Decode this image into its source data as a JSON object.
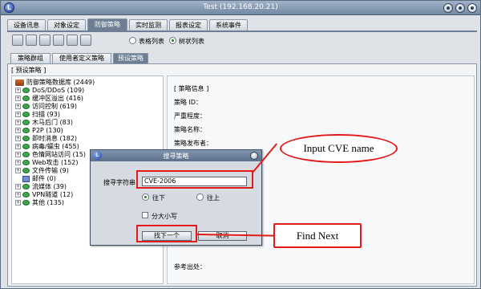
{
  "window": {
    "title": "Test (192.168.20.21)"
  },
  "main_tabs": [
    "设备讯息",
    "对象设定",
    "防御策略",
    "实时监测",
    "报表设定",
    "系统事件"
  ],
  "view_options": {
    "table_list": "表格列表",
    "tree_list": "树状列表"
  },
  "sub_tabs": [
    "策略群组",
    "使用者定义策略",
    "预设策略"
  ],
  "panel_label": "[ 预设策略 ]",
  "tree": {
    "root": "防御策略数据库 (2449)",
    "items": [
      "DoS/DDoS (109)",
      "缓冲区溢出 (416)",
      "访问控制 (619)",
      "扫描 (93)",
      "木马后门 (83)",
      "P2P (130)",
      "即时消息 (182)",
      "病毒/蠕虫 (455)",
      "色情网站访问 (15)",
      "Web攻击 (152)",
      "文件传输 (9)",
      "邮件 (0)",
      "流媒体 (39)",
      "VPN隧道 (12)",
      "其他 (135)"
    ]
  },
  "detail": {
    "header": "[ 策略信息 ]",
    "fields": [
      "策略 ID：",
      "严重程度：",
      "策略名称：",
      "策略发布者："
    ],
    "reference": "参考出处："
  },
  "dialog": {
    "title": "搜寻策略",
    "search_label": "搜寻字符串",
    "search_value": "CVE-2006",
    "direction_down": "往下",
    "direction_up": "往上",
    "match_case": "分大小写",
    "find_next": "找下一个",
    "cancel": "取消"
  },
  "annotations": {
    "input_callout": "Input CVE name",
    "find_callout": "Find Next",
    "color": "#e21a1a"
  }
}
